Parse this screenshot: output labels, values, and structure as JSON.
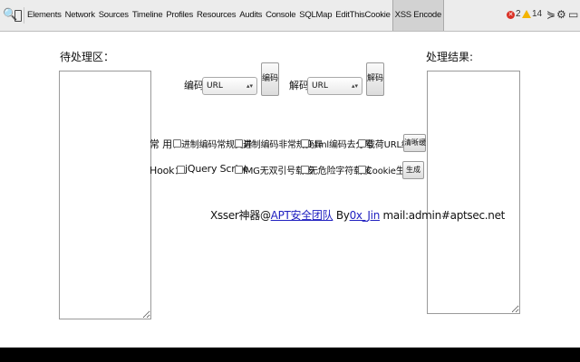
{
  "toolbar": {
    "tabs": [
      "Elements",
      "Network",
      "Sources",
      "Timeline",
      "Profiles",
      "Resources",
      "Audits",
      "Console",
      "SQLMap",
      "EditThisCookie",
      "XSS Encode"
    ],
    "active_tab": "XSS Encode",
    "error_count": "2",
    "warning_count": "14",
    "icons": {
      "search": "🔍",
      "console_drawer": "⋟",
      "settings": "⚙",
      "dock": "▭"
    },
    "colors": {
      "error": "#d93025",
      "warning": "#f4b400"
    }
  },
  "encoder": {
    "input_label": "待处理区：",
    "output_label": "处理结果:",
    "encode_label": "编码:",
    "encode_select": "URL",
    "encode_button": "编码",
    "decode_label": "解码:",
    "decode_select": "URL",
    "decode_button": "解码"
  },
  "common": {
    "label": "常  用：",
    "options": [
      "进制编码常规变异",
      "进制编码非常规变异",
      "html编码去分号",
      "载荷URL编码"
    ],
    "button": "清晰缓"
  },
  "hook": {
    "label": "Hook：",
    "options": [
      "jQuery Script",
      "IMG无双引号载核",
      "无危险字符载核",
      "Cookie生成"
    ],
    "button": "生成"
  },
  "credit": {
    "prefix": "Xsser神器@",
    "team_link": "APT安全团队",
    "by": " By",
    "author_link": "0x_Jin",
    "mail": " mail:admin#aptsec.net"
  }
}
